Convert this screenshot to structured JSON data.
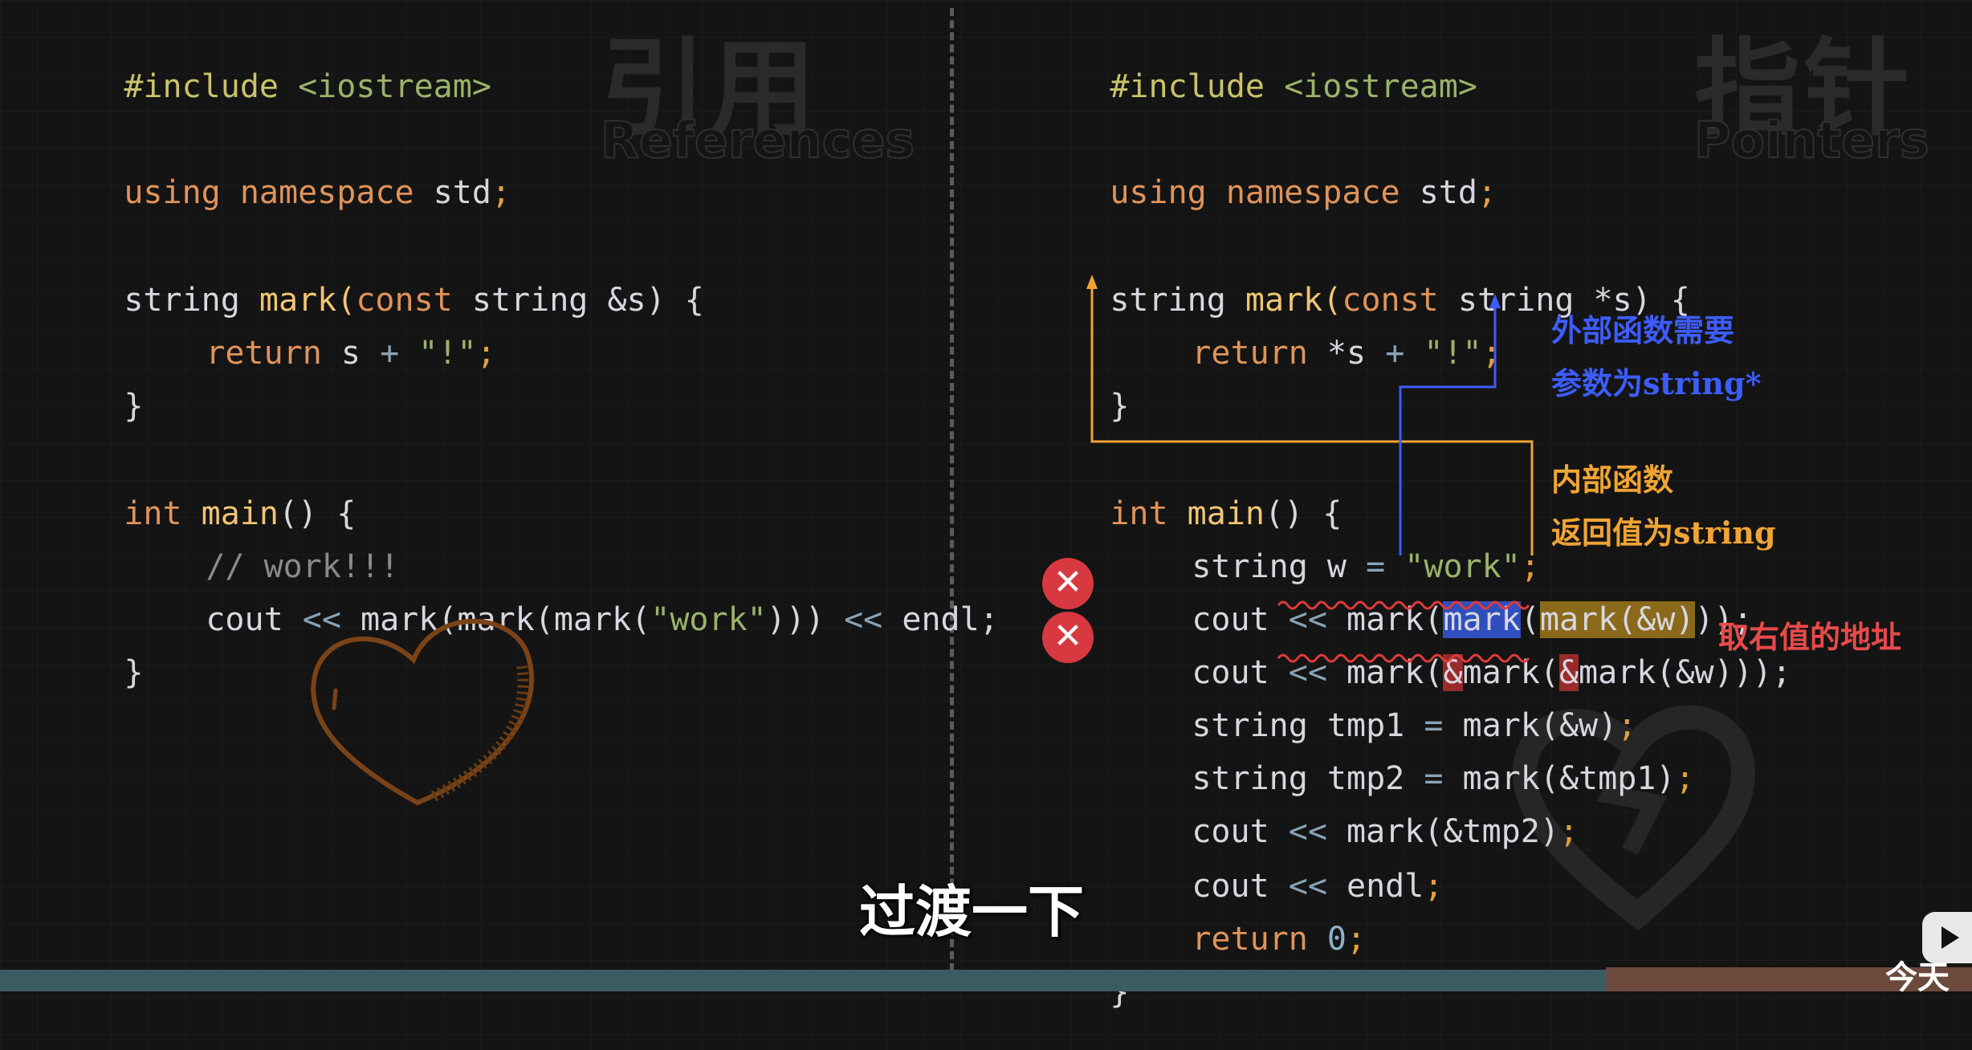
{
  "colors": {
    "background": "#141414",
    "preprocessor": "#c9c26a",
    "keyword_orange": "#e0935a",
    "function_gold": "#f0c674",
    "string_green": "#9ab36a",
    "comment": "#8a8a8a",
    "operator": "#8aa3b5",
    "number": "#8cb2c9",
    "annotation_blue": "#3d5dff",
    "annotation_orange": "#f0a434",
    "annotation_red": "#e84a4a",
    "error_red": "#d8383f"
  },
  "left": {
    "watermark_cn": "引用",
    "watermark_en": "References",
    "lines": {
      "l1": {
        "a": "#include",
        "b": "<iostream>"
      },
      "l2": {
        "a": "using",
        "b": "namespace",
        "c": "std",
        "d": ";"
      },
      "l3": {
        "a": "string",
        "b": "mark",
        "c": "(",
        "d": "const",
        "e": "string",
        "f": "&s) {"
      },
      "l4": {
        "a": "return",
        "b": "s",
        "c": "+",
        "d": "\"!\"",
        "e": ";"
      },
      "l5": {
        "a": "}"
      },
      "l6": {
        "a": "int",
        "b": "main",
        "c": "() {"
      },
      "l7": {
        "a": "// work!!!"
      },
      "l8": {
        "a": "cout",
        "b": "<<",
        "c": "mark(mark(mark(",
        "d": "\"work\"",
        "e": ")))",
        "f": "<<",
        "g": "endl;"
      },
      "l9": {
        "a": "}"
      }
    }
  },
  "right": {
    "watermark_cn": "指针",
    "watermark_en": "Pointers",
    "lines": {
      "l1": {
        "a": "#include",
        "b": "<iostream>"
      },
      "l2": {
        "a": "using",
        "b": "namespace",
        "c": "std",
        "d": ";"
      },
      "l3": {
        "a": "string",
        "b": "mark",
        "c": "(",
        "d": "const",
        "e": "string",
        "f": "*s) {"
      },
      "l4": {
        "a": "return",
        "b": "*s",
        "c": "+",
        "d": "\"!\"",
        "e": ";"
      },
      "l5": {
        "a": "}"
      },
      "l6": {
        "a": "int",
        "b": "main",
        "c": "() {"
      },
      "l7": {
        "a": "string",
        "b": "w",
        "c": "=",
        "d": "\"work\"",
        "e": ";"
      },
      "l8": {
        "a": "cout",
        "b": "<<",
        "c": "mark(",
        "d": "mark",
        "e": "(",
        "f": "mark(&w)",
        "g": "));"
      },
      "l9": {
        "a": "cout",
        "b": "<<",
        "c": "mark(",
        "d": "&",
        "e": "mark(",
        "f": "&",
        "g": "mark(&w)));"
      },
      "l10": {
        "a": "string",
        "b": "tmp1",
        "c": "=",
        "d": "mark(&w)",
        "e": ";"
      },
      "l11": {
        "a": "string",
        "b": "tmp2",
        "c": "=",
        "d": "mark(&tmp1)",
        "e": ";"
      },
      "l12": {
        "a": "cout",
        "b": "<<",
        "c": "mark(&tmp2)",
        "d": ";"
      },
      "l13": {
        "a": "cout",
        "b": "<<",
        "c": "endl",
        "d": ";"
      },
      "l14": {
        "a": "return",
        "b": "0",
        "c": ";"
      },
      "l15": {
        "a": "}"
      }
    },
    "error_icon_symbol": "✕",
    "annotations": {
      "outer_line1": "外部函数需要",
      "outer_line2": "参数为string*",
      "inner_line1": "内部函数",
      "inner_line2": "返回值为string",
      "rvalue_note": "取右值的地址"
    }
  },
  "subtitle": "过渡一下",
  "corner_text": "今天"
}
